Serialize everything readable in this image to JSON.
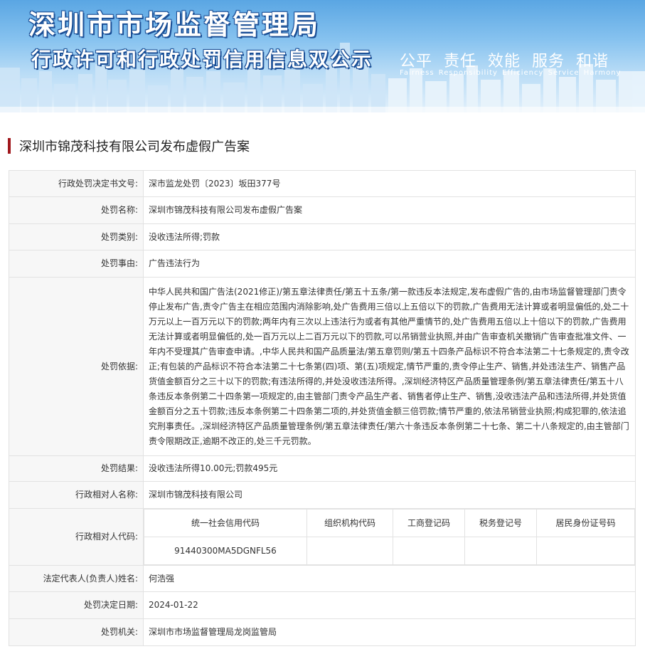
{
  "banner": {
    "title": "深圳市市场监督管理局",
    "subtitle": "行政许可和行政处罚信用信息双公示",
    "slogan": "公平 责任 效能 服务 和谐",
    "slogan_en": "Fairness Responsibility Efficiency Service Harmony"
  },
  "case_title": "深圳市锦茂科技有限公司发布虚假广告案",
  "rows": {
    "decision_no": {
      "label": "行政处罚决定书文号:",
      "value": "深市监龙处罚〔2023〕坂田377号"
    },
    "penalty_name": {
      "label": "处罚名称:",
      "value": "深圳市锦茂科技有限公司发布虚假广告案"
    },
    "penalty_type": {
      "label": "处罚类别:",
      "value": "没收违法所得;罚款"
    },
    "penalty_reason": {
      "label": "处罚事由:",
      "value": "广告违法行为"
    },
    "penalty_basis": {
      "label": "处罚依据:",
      "value": "中华人民共和国广告法(2021修正)/第五章法律责任/第五十五条/第一款违反本法规定,发布虚假广告的,由市场监督管理部门责令停止发布广告,责令广告主在相应范围内消除影响,处广告费用三倍以上五倍以下的罚款,广告费用无法计算或者明显偏低的,处二十万元以上一百万元以下的罚款;两年内有三次以上违法行为或者有其他严重情节的,处广告费用五倍以上十倍以下的罚款,广告费用无法计算或者明显偏低的,处一百万元以上二百万元以下的罚款,可以吊销营业执照,并由广告审查机关撤销广告审查批准文件、一年内不受理其广告审查申请。,中华人民共和国产品质量法/第五章罚则/第五十四条产品标识不符合本法第二十七条规定的,责令改正;有包装的产品标识不符合本法第二十七条第(四)项、第(五)项规定,情节严重的,责令停止生产、销售,并处违法生产、销售产品货值金额百分之三十以下的罚款;有违法所得的,并处没收违法所得。,深圳经济特区产品质量管理条例/第五章法律责任/第五十八条违反本条例第二十四条第一项规定的,由主管部门责令产品生产者、销售者停止生产、销售,没收违法产品和违法所得,并处货值金额百分之五十罚款;违反本条例第二十四条第二项的,并处货值金额三倍罚款;情节严重的,依法吊销营业执照;构成犯罪的,依法追究刑事责任。,深圳经济特区产品质量管理条例/第五章法律责任/第六十条违反本条例第二十七条、第二十八条规定的,由主管部门责令限期改正,逾期不改正的,处三千元罚款。"
    },
    "penalty_result": {
      "label": "处罚结果:",
      "value": "没收违法所得10.00元;罚款495元"
    },
    "party_name": {
      "label": "行政相对人名称:",
      "value": "深圳市锦茂科技有限公司"
    },
    "party_code": {
      "label": "行政相对人代码:",
      "headers": [
        "统一社会信用代码",
        "组织机构代码",
        "工商登记码",
        "税务登记号",
        "居民身份证号码"
      ],
      "values": [
        "91440300MA5DGNFL56",
        "",
        "",
        "",
        ""
      ]
    },
    "legal_rep": {
      "label": "法定代表人(负责人)姓名:",
      "value": "何浩强"
    },
    "decision_date": {
      "label": "处罚决定日期:",
      "value": "2024-01-22"
    },
    "authority": {
      "label": "处罚机关:",
      "value": "深圳市市场监督管理局龙岗监管局"
    }
  }
}
